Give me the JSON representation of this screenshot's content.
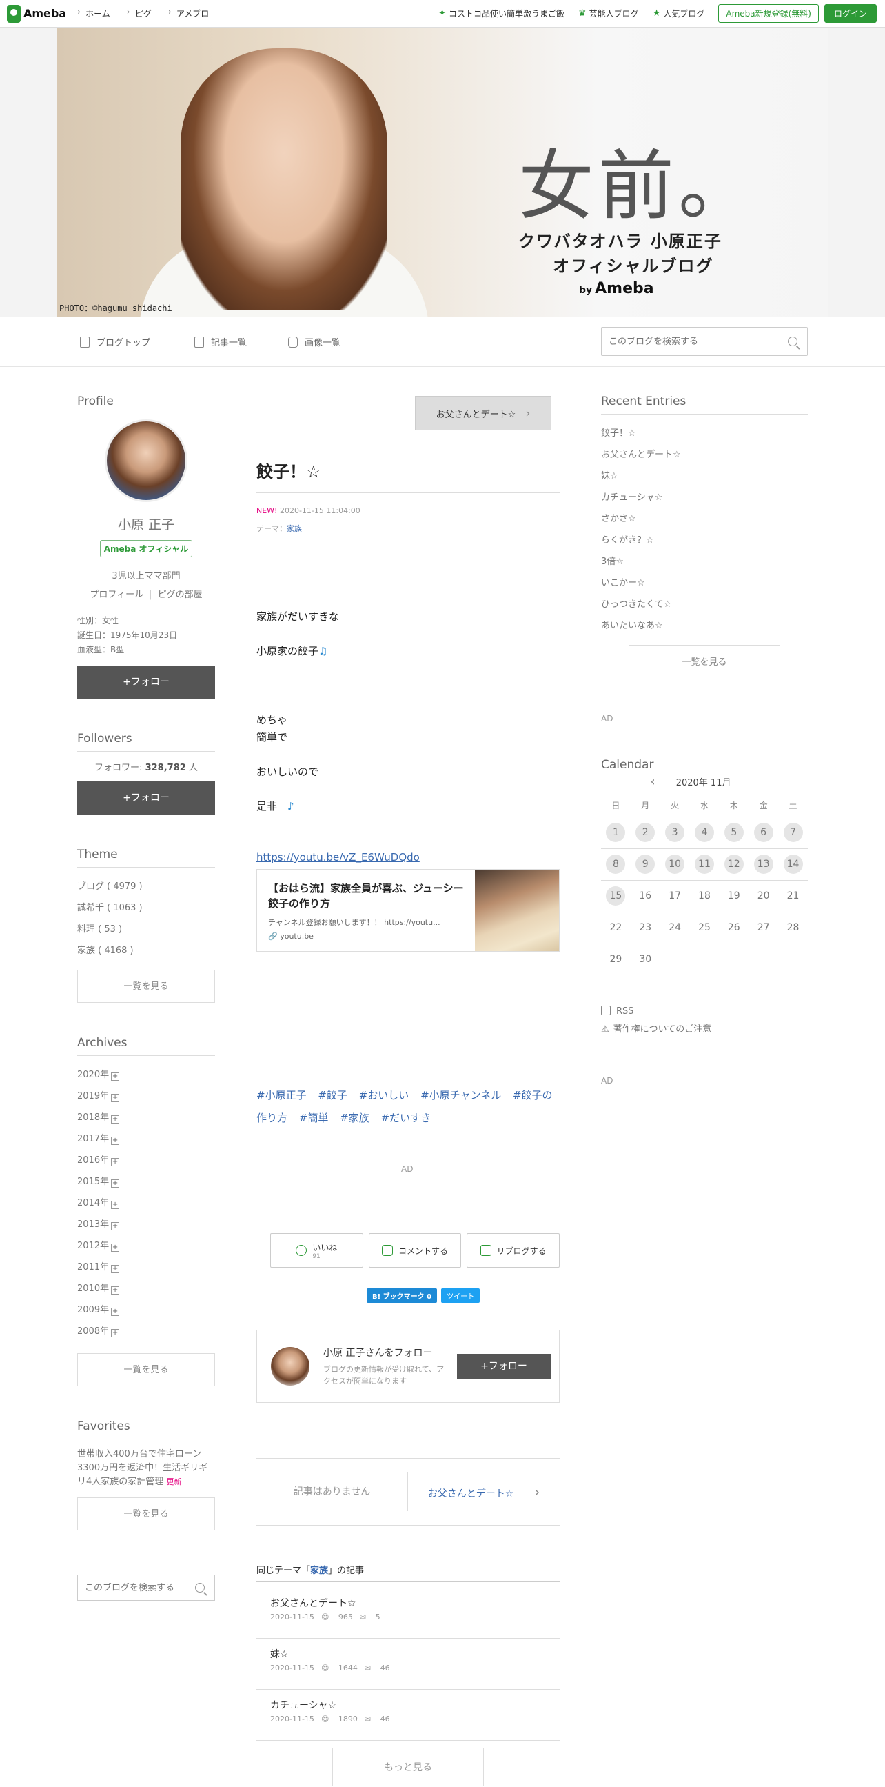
{
  "topbar": {
    "logo": "Ameba",
    "nav": [
      "ホーム",
      "ピグ",
      "アメブロ"
    ],
    "links": [
      "コストコ品使い簡単激うまご飯",
      "芸能人ブログ",
      "人気ブログ"
    ],
    "register": "Ameba新規登録(無料)",
    "login": "ログイン"
  },
  "header": {
    "title_main": "女前。",
    "title_sub1": "クワバタオハラ 小原正子",
    "title_sub2": "オフィシャルブログ",
    "by": "by",
    "brand": "Ameba",
    "photo_credit": "PHOTO：©hagumu shidachi"
  },
  "blognav": {
    "items": [
      "ブログトップ",
      "記事一覧",
      "画像一覧"
    ],
    "search_placeholder": "このブログを検索する"
  },
  "profile": {
    "section": "Profile",
    "name": "小原 正子",
    "badge": "Ameba オフィシャル",
    "desc": "3児以上ママ部門",
    "link1": "プロフィール",
    "link2": "ピグの部屋",
    "gender": "性別：女性",
    "birthday": "誕生日：1975年10月23日",
    "blood": "血液型：B型",
    "follow": "+フォロー"
  },
  "followers": {
    "section": "Followers",
    "label": "フォロワー:",
    "count": "328,782",
    "unit": "人",
    "follow": "+フォロー"
  },
  "theme": {
    "section": "Theme",
    "items": [
      "ブログ ( 4979 )",
      "誠希千 ( 1063 )",
      "料理 ( 53 )",
      "家族 ( 4168 )"
    ],
    "more": "一覧を見る"
  },
  "archives": {
    "section": "Archives",
    "years": [
      "2020年",
      "2019年",
      "2018年",
      "2017年",
      "2016年",
      "2015年",
      "2014年",
      "2013年",
      "2012年",
      "2011年",
      "2010年",
      "2009年",
      "2008年"
    ],
    "more": "一覧を見る"
  },
  "favorites": {
    "section": "Favorites",
    "text": "世帯収入400万台で住宅ローン3300万円を返済中！生活ギリギリ4人家族の家計管理",
    "updated": "更新",
    "more": "一覧を見る"
  },
  "left_search_placeholder": "このブログを検索する",
  "entry": {
    "next_title": "お父さんとデート☆",
    "title": "餃子！☆",
    "new": "NEW!",
    "date": "2020-11-15 11:04:00",
    "theme_label": "テーマ：",
    "theme": "家族",
    "line1": "家族がだいすきな",
    "line2": "小原家の餃子",
    "line3": "めちゃ",
    "line4": "簡単で",
    "line5": "おいしいので",
    "line6": "是非",
    "youtube_url": "https://youtu.be/vZ_E6WuDQdo",
    "card_title": "【おはら流】家族全員が喜ぶ、ジューシー餃子の作り方",
    "card_desc": "チャンネル登録お願いします！！ https://youtu...",
    "card_site": "youtu.be",
    "tags": [
      "#小原正子",
      "#餃子",
      "#おいしい",
      "#小原チャンネル",
      "#餃子の作り方",
      "#簡単",
      "#家族",
      "#だいすき"
    ],
    "ad": "AD"
  },
  "actions": {
    "like": "いいね",
    "like_count": "91",
    "comment": "コメントする",
    "reblog": "リブログする",
    "hatena": "B! ブックマーク  0",
    "tweet": "ツイート"
  },
  "followbox": {
    "title": "小原 正子さんをフォロー",
    "desc": "ブログの更新情報が受け取れて、アクセスが簡単になります",
    "button": "+フォロー"
  },
  "pager": {
    "prev": "記事はありません",
    "next": "お父さんとデート☆"
  },
  "same_theme": {
    "prefix": "同じテーマ「",
    "theme": "家族",
    "suffix": "」の記事",
    "items": [
      {
        "title": "お父さんとデート☆",
        "date": "2020-11-15",
        "likes": "965",
        "comments": "5"
      },
      {
        "title": "妹☆",
        "date": "2020-11-15",
        "likes": "1644",
        "comments": "46"
      },
      {
        "title": "カチューシャ☆",
        "date": "2020-11-15",
        "likes": "1890",
        "comments": "46"
      }
    ],
    "more": "もっと見る"
  },
  "recent": {
    "section": "Recent Entries",
    "items": [
      "餃子！☆",
      "お父さんとデート☆",
      "妹☆",
      "カチューシャ☆",
      "さかさ☆",
      "らくがき？☆",
      "3倍☆",
      "いこかー☆",
      "ひっつきたくて☆",
      "あいたいなあ☆"
    ],
    "more": "一覧を見る"
  },
  "right_ad": "AD",
  "calendar": {
    "section": "Calendar",
    "month": "2020年 11月",
    "weekdays": [
      "日",
      "月",
      "火",
      "水",
      "木",
      "金",
      "土"
    ],
    "weeks": [
      [
        "1",
        "2",
        "3",
        "4",
        "5",
        "6",
        "7"
      ],
      [
        "8",
        "9",
        "10",
        "11",
        "12",
        "13",
        "14"
      ],
      [
        "15",
        "16",
        "17",
        "18",
        "19",
        "20",
        "21"
      ],
      [
        "22",
        "23",
        "24",
        "25",
        "26",
        "27",
        "28"
      ],
      [
        "29",
        "30",
        "",
        "",
        "",
        "",
        ""
      ]
    ]
  },
  "rss": "RSS",
  "copyright": "著作権についてのご注意",
  "right_ad2": "AD"
}
